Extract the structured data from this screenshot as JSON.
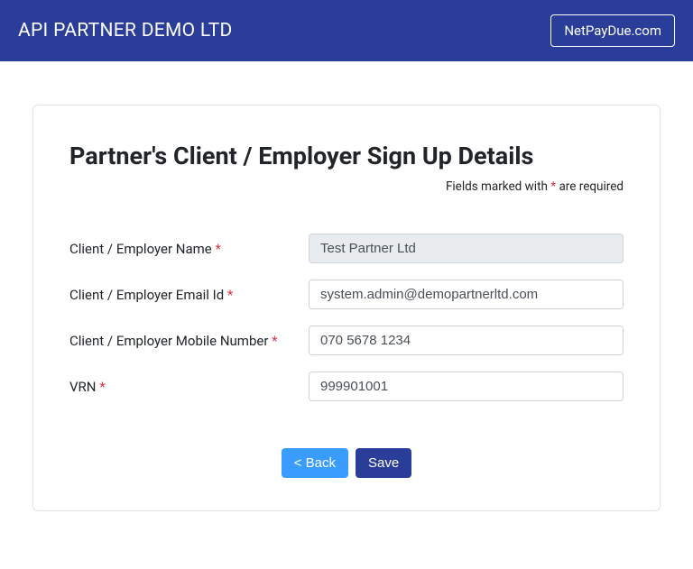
{
  "navbar": {
    "title": "API PARTNER DEMO LTD",
    "link_label": "NetPayDue.com"
  },
  "form": {
    "title": "Partner's Client / Employer Sign Up Details",
    "required_note_prefix": "Fields marked with ",
    "required_note_asterisk": "*",
    "required_note_suffix": " are required",
    "fields": {
      "client_name": {
        "label": "Client / Employer Name ",
        "required": "*",
        "value": "Test Partner Ltd"
      },
      "client_email": {
        "label": "Client / Employer Email Id ",
        "required": "*",
        "value": "system.admin@demopartnerltd.com"
      },
      "client_mobile": {
        "label": "Client / Employer Mobile Number ",
        "required": "*",
        "value": "070 5678 1234"
      },
      "vrn": {
        "label": "VRN ",
        "required": "*",
        "value": "999901001"
      }
    },
    "buttons": {
      "back_label": "< Back",
      "save_label": "Save"
    }
  }
}
